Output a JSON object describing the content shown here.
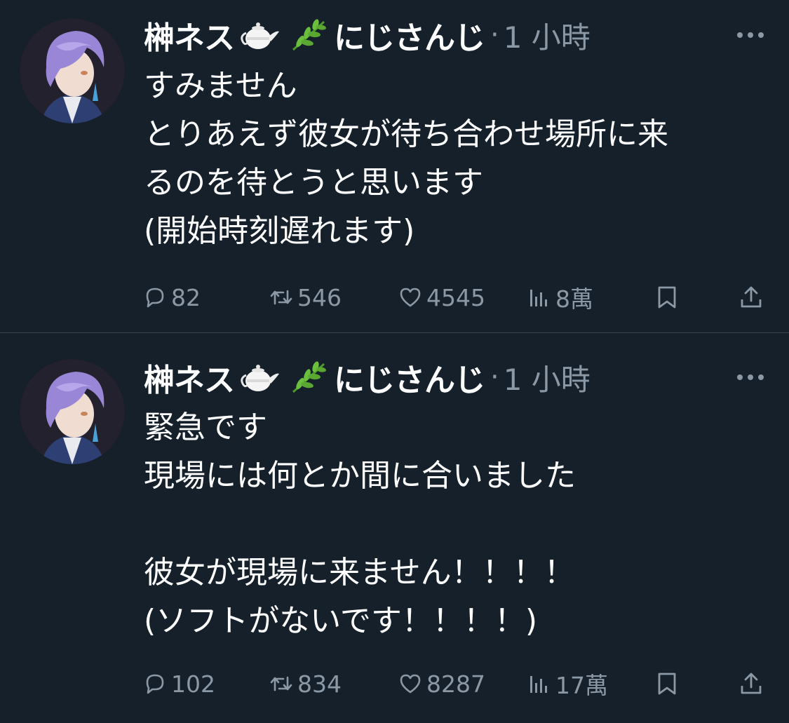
{
  "tweets": [
    {
      "author": {
        "display_name": "榊ネス",
        "emojis": [
          "teapot-emoji",
          "herb-emoji"
        ],
        "affiliation": "にじさんじ"
      },
      "separator": "·",
      "time": "1 小時",
      "text_lines": [
        "すみません",
        "とりあえず彼女が待ち合わせ場所に来",
        "るのを待とうと思います",
        "(開始時刻遅れます)"
      ],
      "stats": {
        "replies": "82",
        "retweets": "546",
        "likes": "4545",
        "views": "8萬"
      }
    },
    {
      "author": {
        "display_name": "榊ネス",
        "emojis": [
          "teapot-emoji",
          "herb-emoji"
        ],
        "affiliation": "にじさんじ"
      },
      "separator": "·",
      "time": "1 小時",
      "text_lines": [
        "緊急です",
        "現場には何とか間に合いました",
        "",
        "彼女が現場に来ません！！！！",
        "(ソフトがないです！！！！)"
      ],
      "stats": {
        "replies": "102",
        "retweets": "834",
        "likes": "8287",
        "views": "17萬"
      }
    }
  ],
  "colors": {
    "background": "#15202b",
    "text": "#ffffff",
    "muted": "#8b98a5",
    "divider": "#38444d",
    "hair": "#9a86d6"
  }
}
